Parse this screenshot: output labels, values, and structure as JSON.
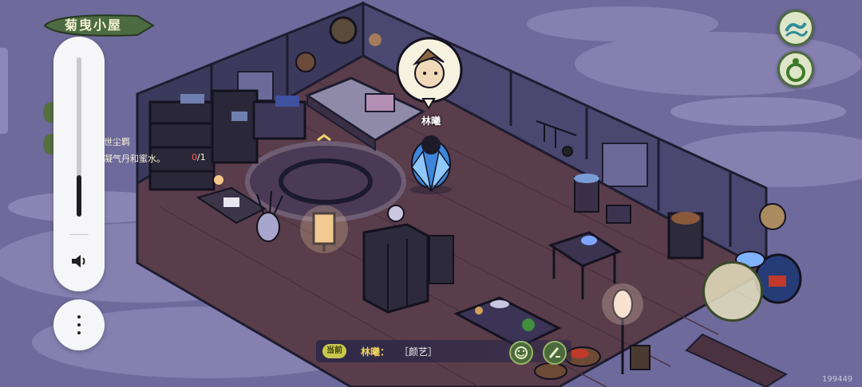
{
  "location_title": "菊曳小屋",
  "npc": {
    "name": "林曦"
  },
  "quest": {
    "line1": "世尘羁",
    "line2": "凝气丹和蜜水。",
    "progress_current": "0",
    "progress_total": "/1"
  },
  "chat": {
    "channel": "当前",
    "speaker": "林曦：",
    "message": "［颜艺］"
  },
  "volume": {
    "level": 0.26
  },
  "watermark": "199449",
  "icons": {
    "top_right_1": "wave-icon",
    "top_right_2": "gourd-icon",
    "emote": "smile-icon",
    "chat": "brush-icon",
    "volume": "speaker-icon",
    "more": "more-vertical-icon"
  },
  "colors": {
    "night_sky": "#6f6a9c",
    "floor": "#5a3d4a",
    "wall": "#3c3a5c",
    "accent_green": "#4d6b43"
  }
}
